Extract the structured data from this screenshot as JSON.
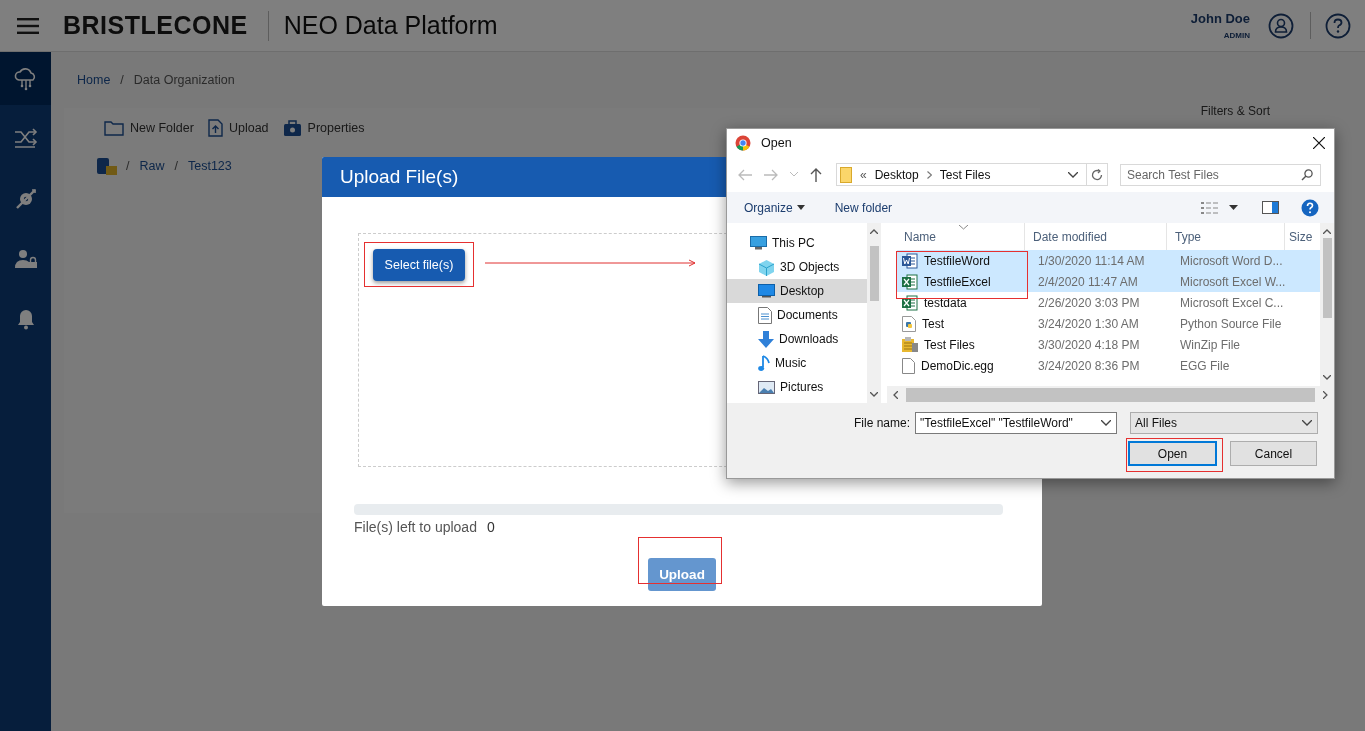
{
  "header": {
    "logo": "BRISTLECONE",
    "app_title": "NEO Data Platform",
    "user_name": "John Doe",
    "user_role": "ADMIN"
  },
  "sidebar": {
    "items": [
      {
        "kind": "cloud",
        "selected": true
      },
      {
        "kind": "shuffle",
        "selected": false
      },
      {
        "kind": "tools",
        "selected": false
      },
      {
        "kind": "user-lock",
        "selected": false
      },
      {
        "kind": "bell",
        "selected": false
      }
    ]
  },
  "breadcrumb": [
    "Home",
    "Data Organization"
  ],
  "separator": "/",
  "toolbar": [
    {
      "kind": "folder",
      "label": "New Folder"
    },
    {
      "kind": "upload",
      "label": "Upload"
    },
    {
      "kind": "properties",
      "label": "Properties"
    }
  ],
  "filters_label": "Filters & Sort",
  "folder_path": [
    "Raw",
    "Test123"
  ],
  "upload_modal": {
    "title": "Upload File(s)",
    "select_button": "Select file(s)",
    "progress": {
      "level": 0
    },
    "left_label": "File(s) left to upload",
    "left_count": "0",
    "upload_button": "Upload"
  },
  "open_dialog": {
    "title": "Open",
    "path_prefix": "«",
    "path": [
      "Desktop",
      "Test Files"
    ],
    "search_placeholder": "Search Test Files",
    "commands": [
      "Organize",
      "New folder"
    ],
    "nav_tree": [
      {
        "label": "This PC",
        "kind": "pc",
        "selected": false,
        "children": [
          {
            "label": "3D Objects",
            "kind": "cube",
            "selected": false
          },
          {
            "label": "Desktop",
            "kind": "desktop",
            "selected": true
          },
          {
            "label": "Documents",
            "kind": "documents",
            "selected": false
          },
          {
            "label": "Downloads",
            "kind": "downloads",
            "selected": false
          },
          {
            "label": "Music",
            "kind": "music",
            "selected": false
          },
          {
            "label": "Pictures",
            "kind": "pictures",
            "selected": false
          }
        ]
      }
    ],
    "columns": [
      "Name",
      "Date modified",
      "Type",
      "Size"
    ],
    "files": [
      {
        "name": "TestfileWord",
        "date": "1/30/2020 11:14 AM",
        "type": "Microsoft Word D...",
        "kind": "word",
        "selected": true
      },
      {
        "name": "TestfileExcel",
        "date": "2/4/2020 11:47 AM",
        "type": "Microsoft Excel W...",
        "kind": "excel",
        "selected": true
      },
      {
        "name": "testdata",
        "date": "2/26/2020 3:03 PM",
        "type": "Microsoft Excel C...",
        "kind": "csv",
        "selected": false
      },
      {
        "name": "Test",
        "date": "3/24/2020 1:30 AM",
        "type": "Python Source File",
        "kind": "python",
        "selected": false
      },
      {
        "name": "Test Files",
        "date": "3/30/2020 4:18 PM",
        "type": "WinZip File",
        "kind": "zip",
        "selected": false
      },
      {
        "name": "DemoDic.egg",
        "date": "3/24/2020 8:36 PM",
        "type": "EGG File",
        "kind": "file",
        "selected": false
      }
    ],
    "file_name_label": "File name:",
    "file_name": "\"TestfileExcel\" \"TestfileWord\"",
    "file_type": "All Files",
    "buttons": [
      "Open",
      "Cancel"
    ]
  }
}
